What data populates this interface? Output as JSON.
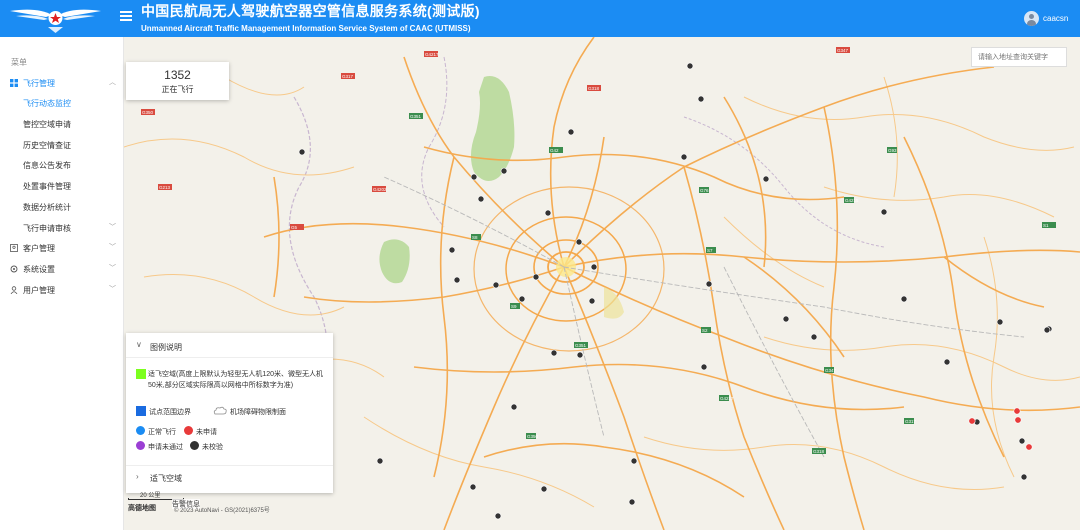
{
  "header": {
    "title": "中国民航局无人驾驶航空器空管信息服务系统(测试版)",
    "subtitle": "Unmanned Aircraft Traffic Management Information Service System of CAAC (UTMISS)",
    "username": "caacsn",
    "bg_color": "#1b8cf3"
  },
  "sidebar": {
    "heading": "菜单",
    "groups": [
      {
        "label": "飞行管理",
        "icon": "grid-icon",
        "expanded": true
      },
      {
        "label": "客户管理",
        "icon": "user-icon"
      },
      {
        "label": "系统设置",
        "icon": "gear-icon"
      },
      {
        "label": "用户管理",
        "icon": "person-icon"
      }
    ],
    "sub_items": [
      "飞行动态监控",
      "管控空域申请",
      "历史空情查证",
      "信息公告发布",
      "处置事件管理",
      "数据分析统计",
      "飞行申请审核"
    ]
  },
  "stats": {
    "count": "1352",
    "label": "正在飞行"
  },
  "search": {
    "placeholder": "请输入地址查询关键字"
  },
  "legend": {
    "header": "图例说明",
    "green_text": "适飞空域(高度上限默认为轻型无人机120米、微型无人机50米,部分区域实际限高以网格中所标数字为准)",
    "blue_text": "试点范围边界",
    "cloud_text": "机场障碍物限制面",
    "markers": [
      "正常飞行",
      "未申请",
      "申请未通过",
      "未校验"
    ],
    "section2": "适飞空域",
    "alert": "告警信息"
  },
  "map": {
    "scale_label": "20 公里",
    "attribution_logo": "高德地图",
    "attribution": "© 2023 AutoNavi - GS(2021)6375号",
    "road_labels": [
      "G347",
      "G4217",
      "G317",
      "G318",
      "G350",
      "G351",
      "G213",
      "G4202",
      "G5",
      "G42",
      "G76",
      "G93",
      "G4215",
      "S7",
      "S8",
      "S9",
      "S2",
      "S1"
    ]
  }
}
